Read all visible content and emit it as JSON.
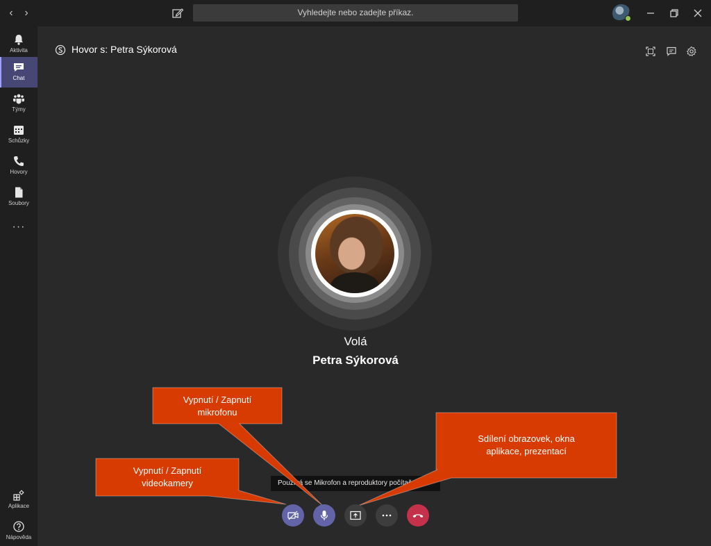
{
  "titlebar": {
    "search_placeholder": "Vyhledejte nebo zadejte příkaz.",
    "back_icon": "chevron-left-icon",
    "forward_icon": "chevron-right-icon"
  },
  "rail": {
    "items": [
      {
        "label": "Aktivita",
        "icon": "bell-icon"
      },
      {
        "label": "Chat",
        "icon": "chat-icon",
        "active": true
      },
      {
        "label": "Týmy",
        "icon": "teams-icon"
      },
      {
        "label": "Schůzky",
        "icon": "calendar-icon"
      },
      {
        "label": "Hovory",
        "icon": "phone-icon"
      },
      {
        "label": "Soubory",
        "icon": "file-icon"
      }
    ],
    "more": "···",
    "bottom": [
      {
        "label": "Aplikace",
        "icon": "apps-icon"
      },
      {
        "label": "Nápověda",
        "icon": "help-icon"
      }
    ]
  },
  "call": {
    "title": "Hovor s: Petra Sýkorová",
    "status": "Volá",
    "callee": "Petra Sýkorová",
    "device_tip": "Používá se Mikrofon a reproduktory počítače"
  },
  "callouts": {
    "microphone": [
      "Vypnutí / Zapnutí",
      "mikrofonu"
    ],
    "camera": [
      "Vypnutí / Zapnutí",
      "videokamery"
    ],
    "share": [
      "Sdílení obrazovek, okna",
      "aplikace, prezentací"
    ]
  },
  "colors": {
    "accent": "#6264a7",
    "hangup": "#c4314b",
    "callout": "#d83b01",
    "presence": "#92c353"
  }
}
